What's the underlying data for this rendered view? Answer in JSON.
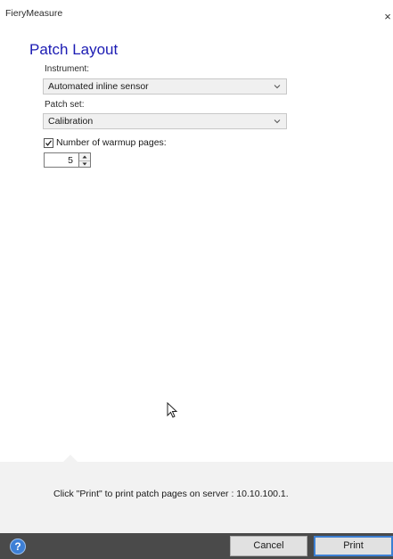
{
  "window": {
    "title": "FieryMeasure",
    "close_glyph": "×"
  },
  "page": {
    "title": "Patch Layout"
  },
  "instrument": {
    "label": "Instrument:",
    "value": "Automated inline sensor"
  },
  "patch_set": {
    "label": "Patch set:",
    "value": "Calibration"
  },
  "warmup": {
    "checked": true,
    "label": "Number of warmup pages:",
    "value": "5"
  },
  "info": {
    "message": "Click \"Print\" to print patch pages on server : 10.10.100.1."
  },
  "footer": {
    "help_glyph": "?",
    "cancel_label": "Cancel",
    "print_label": "Print"
  },
  "colors": {
    "title_blue": "#1b1bb3",
    "footer_bar": "#4a4a4a",
    "help_blue": "#3d7fd6",
    "print_border": "#3c7fd2"
  },
  "icons": [
    "close-icon",
    "chevron-down-icon",
    "checkmark-icon",
    "spin-up-icon",
    "spin-down-icon",
    "mouse-cursor-icon",
    "help-icon"
  ]
}
